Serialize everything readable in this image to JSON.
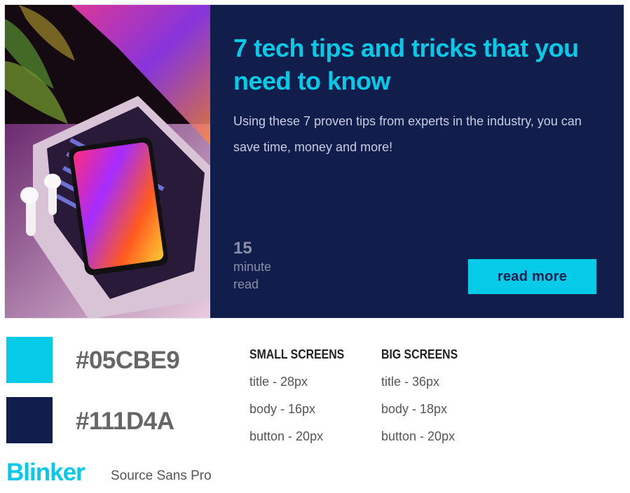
{
  "card": {
    "title": "7 tech tips and tricks that you need to know",
    "body": "Using these 7 proven tips from experts in the industry, you can save time, money and more!",
    "read_time_number": "15",
    "read_time_unit_1": "minute",
    "read_time_unit_2": "read",
    "button_label": "read more",
    "image_icon": "laptop-phone-photo"
  },
  "palette": {
    "primary_hex": "#05CBE9",
    "secondary_hex": "#111D4A",
    "primary_color": "#05cbe9",
    "secondary_color": "#111d4a"
  },
  "specs": {
    "small": {
      "heading": "SMALL SCREENS",
      "title": "title - 28px",
      "body": "body - 16px",
      "button": "button - 20px"
    },
    "big": {
      "heading": "BIG SCREENS",
      "title": "title - 36px",
      "body": "body - 18px",
      "button": "button - 20px"
    }
  },
  "fonts": {
    "heading_font": "Blinker",
    "body_font": "Source Sans Pro"
  }
}
